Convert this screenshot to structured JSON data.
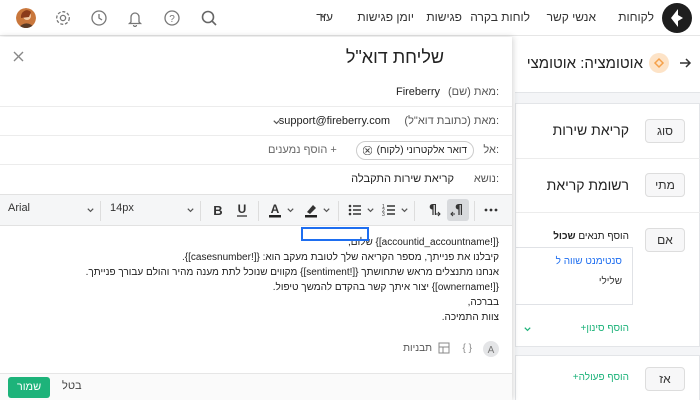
{
  "nav": {
    "items": [
      "לקוחות",
      "אנשי קשר",
      "לוחות בקרה",
      "פגישות",
      "יומן פגישות",
      "עוד"
    ]
  },
  "bg": {
    "title": "אוטומציה: אוטומצי",
    "rows": [
      {
        "tag": "סוג",
        "text": "קריאת שירות"
      },
      {
        "tag": "מתי",
        "text": "רשומת קריאת"
      },
      {
        "tag": "אם",
        "text": "הוסף תנאים",
        "bold": "שכול"
      }
    ],
    "condition_field": "סנטימנט שווה ל",
    "condition_value": "שלילי",
    "add_filter": "הוסף סינון",
    "then_tag": "אז",
    "add_action": "הוסף פעולה"
  },
  "modal": {
    "title": "שליחת דוא\"ל",
    "from_name_label": "מאת (שם):",
    "from_name_value": "Fireberry",
    "from_email_label": "מאת (כתובת דוא\"ל):",
    "from_email_value": "support@fireberry.com",
    "to_label": "אל:",
    "recipient_chip": "דואר אלקטרוני (לקוח)",
    "add_recipients": "הוסף נמענים",
    "subject_label": "נושא:",
    "subject_value": "קריאת שירות התקבלה",
    "font": "Arial",
    "size": "14px",
    "body": [
      "{[!accountid_accountname]} שלום,",
      "קיבלנו את פנייתך, מספר הקריאה שלך לטובת מעקב הוא: {[!casesnumber]}.",
      "אנחנו מתנצלים מראש שתחושתך  {[!sentiment]}  מקווים שנוכל לתת מענה מהיר והולם עבורך פנייתך.",
      "{[!ownername]} יצור איתך קשר בהקדם להמשך טיפול.",
      "בברכה,",
      "צוות התמיכה."
    ],
    "templates": "תבניות",
    "cancel": "בטל",
    "save": "שמור"
  },
  "colors": {
    "accent": "#1e6ef0",
    "save": "#1db37a",
    "orange": "#f5a04a"
  }
}
